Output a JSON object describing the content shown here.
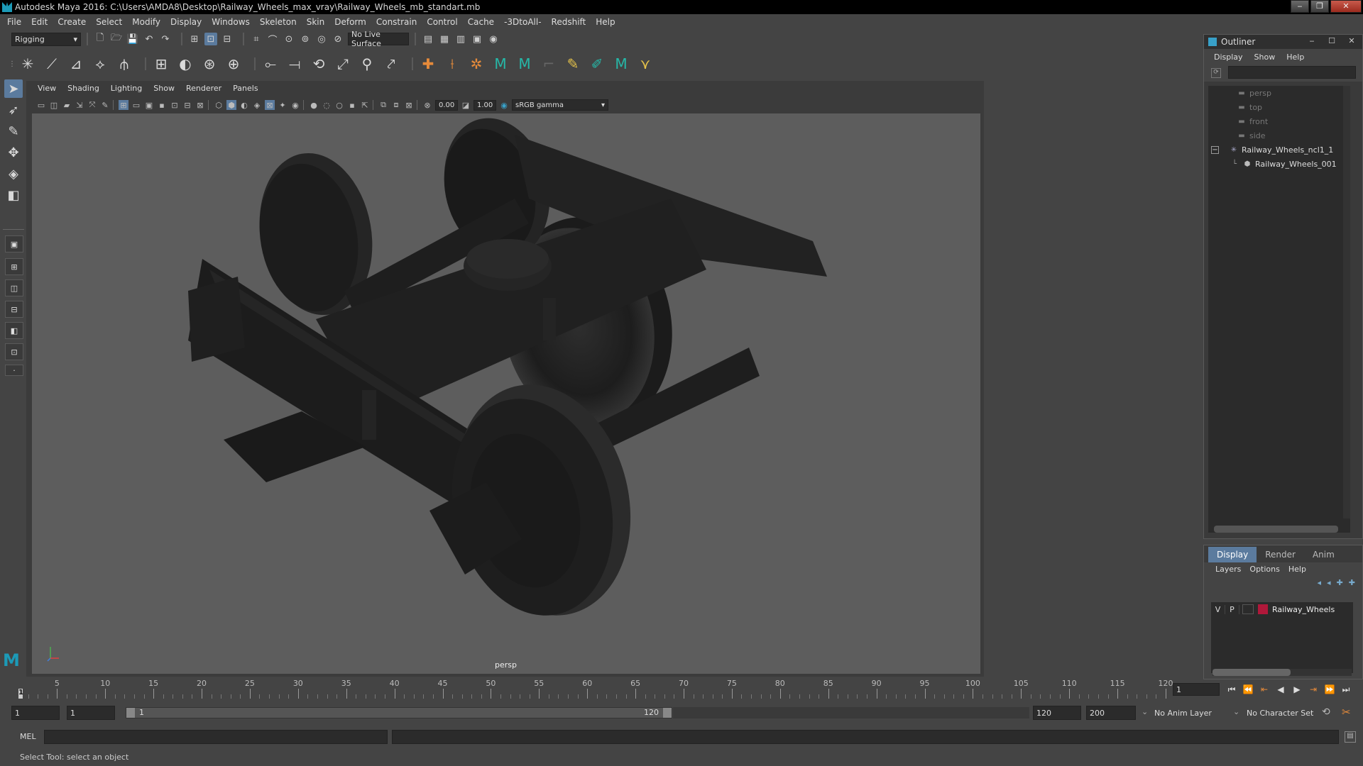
{
  "window": {
    "title": "Autodesk Maya 2016: C:\\Users\\AMDA8\\Desktop\\Railway_Wheels_max_vray\\Railway_Wheels_mb_standart.mb"
  },
  "menubar": [
    "File",
    "Edit",
    "Create",
    "Select",
    "Modify",
    "Display",
    "Windows",
    "Skeleton",
    "Skin",
    "Deform",
    "Constrain",
    "Control",
    "Cache",
    "-3DtoAll-",
    "Redshift",
    "Help"
  ],
  "statusline": {
    "menuset": "Rigging",
    "live_surface": "No Live Surface"
  },
  "viewport": {
    "menu": [
      "View",
      "Shading",
      "Lighting",
      "Show",
      "Renderer",
      "Panels"
    ],
    "exposure": "0.00",
    "gamma": "1.00",
    "colorspace": "sRGB gamma",
    "camera": "persp"
  },
  "outliner": {
    "title": "Outliner",
    "menu": [
      "Display",
      "Show",
      "Help"
    ],
    "items": [
      {
        "label": "persp",
        "icon": "camera-icon",
        "dim": true
      },
      {
        "label": "top",
        "icon": "camera-icon",
        "dim": true
      },
      {
        "label": "front",
        "icon": "camera-icon",
        "dim": true
      },
      {
        "label": "side",
        "icon": "camera-icon",
        "dim": true
      },
      {
        "label": "Railway_Wheels_ncl1_1",
        "icon": "group-icon",
        "dim": false
      },
      {
        "label": "Railway_Wheels_001",
        "icon": "mesh-icon",
        "dim": false
      }
    ]
  },
  "layers": {
    "tabs": [
      "Display",
      "Render",
      "Anim"
    ],
    "active_tab": "Display",
    "menu": [
      "Layers",
      "Options",
      "Help"
    ],
    "layer": {
      "v": "V",
      "p": "P",
      "name": "Railway_Wheels",
      "color": "#b0183a"
    }
  },
  "timeline": {
    "ticks": [
      "5",
      "10",
      "15",
      "20",
      "25",
      "30",
      "35",
      "40",
      "45",
      "50",
      "55",
      "60",
      "65",
      "70",
      "75",
      "80",
      "85",
      "90",
      "95",
      "100",
      "105",
      "110",
      "115",
      "120"
    ],
    "current_marker": "1",
    "current_frame": "1"
  },
  "range": {
    "start": "1",
    "playback_start": "1",
    "slider_start": "1",
    "slider_end": "120",
    "playback_end": "120",
    "end": "200",
    "anim_layer": "No Anim Layer",
    "char_set": "No Character Set"
  },
  "command": {
    "label": "MEL"
  },
  "helpline": "Select Tool: select an object",
  "colors": {
    "accent": "#5b7b9e",
    "layer_color": "#b0183a"
  }
}
